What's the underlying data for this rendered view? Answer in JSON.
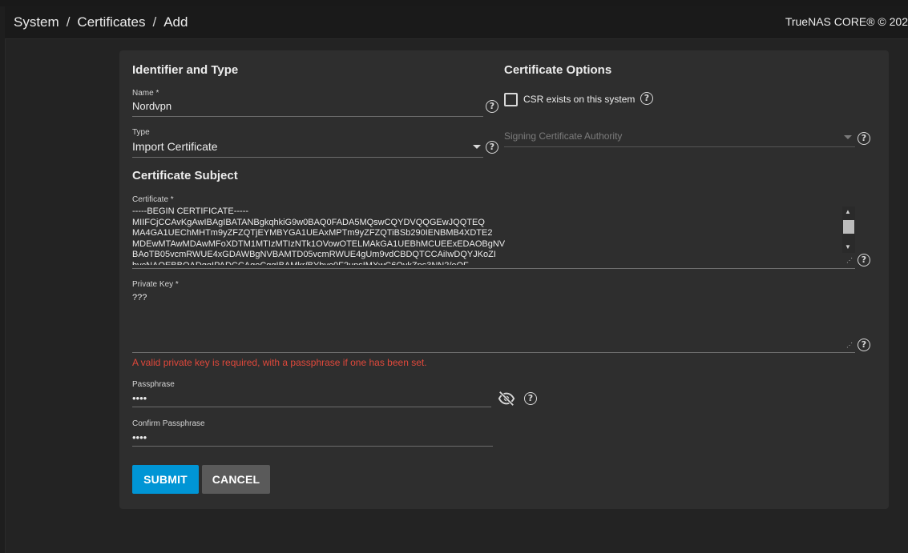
{
  "breadcrumb": {
    "items": [
      "System",
      "Certificates",
      "Add"
    ],
    "separator": "/"
  },
  "header": {
    "brand": "TrueNAS CORE® © 202"
  },
  "identifier_section": {
    "title": "Identifier and Type",
    "name_label": "Name *",
    "name_value": "Nordvpn",
    "type_label": "Type",
    "type_value": "Import Certificate"
  },
  "options_section": {
    "title": "Certificate Options",
    "csr_label": "CSR exists on this system",
    "csr_checked": false,
    "signing_ca_placeholder": "Signing Certificate Authority"
  },
  "subject_section": {
    "title": "Certificate Subject",
    "certificate_label": "Certificate *",
    "certificate_value": "-----BEGIN CERTIFICATE-----\nMIIFCjCCAvKgAwIBAgIBATANBgkqhkiG9w0BAQ0FADA5MQswCQYDVQQGEwJQQTEQ\nMA4GA1UEChMHTm9yZFZQTjEYMBYGA1UEAxMPTm9yZFZQTiBSb290IENBMB4XDTE2\nMDEwMTAwMDAwMFoXDTM1MTIzMTIzNTk1OVowOTELMAkGA1UEBhMCUEExEDAOBgNV\nBAoTB05vcmRWUE4xGDAWBgNVBAMTD05vcmRWUE4gUm9vdCBDQTCCAiIwDQYJKoZI\nhvcNAQEBBQADggIPADCCAgoCggIBAMkr/BYhyo0F2upsIMXwC6QvkZps3NN2/eQF",
    "private_key_label": "Private Key *",
    "private_key_value": "???",
    "private_key_error": "A valid private key is required, with a passphrase if one has been set.",
    "passphrase_label": "Passphrase",
    "passphrase_value": "••••",
    "confirm_passphrase_label": "Confirm Passphrase",
    "confirm_passphrase_value": "••••"
  },
  "actions": {
    "submit_label": "SUBMIT",
    "cancel_label": "CANCEL"
  },
  "colors": {
    "background": "#232323",
    "card": "#2e2e2e",
    "primary": "#0095d5",
    "error": "#e0483b",
    "cancel": "#5a5a5a"
  },
  "icons": {
    "help": "help-circle-icon",
    "dropdown": "caret-down-icon",
    "visibility": "eye-off-icon",
    "resize": "resize-grip-icon"
  }
}
